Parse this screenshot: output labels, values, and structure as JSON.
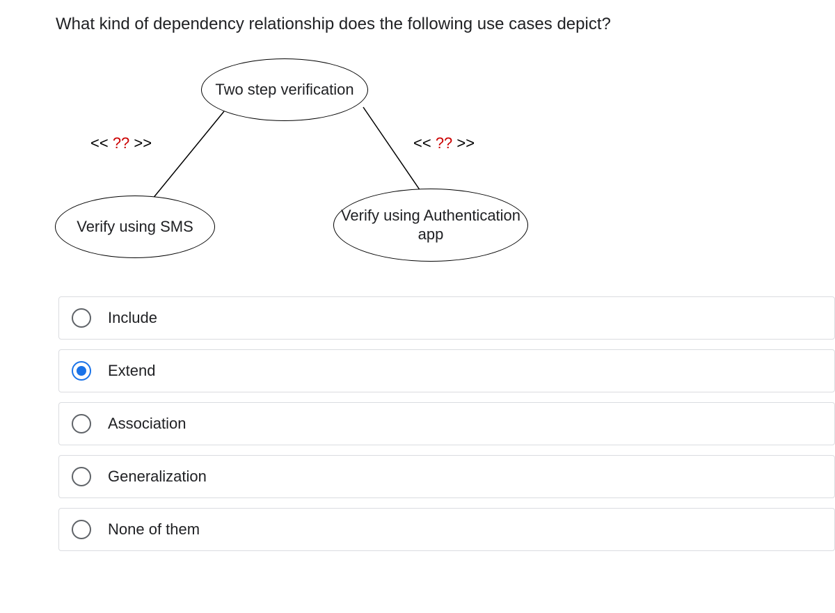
{
  "question": "What kind of dependency relationship does the following use cases depict?",
  "diagram": {
    "top_label": "Two step verification",
    "left_label": "Verify using SMS",
    "right_label": "Verify using Authentication app",
    "stereo_open": "<<",
    "stereo_q": " ?? ",
    "stereo_close": ">>"
  },
  "options": [
    {
      "label": "Include",
      "selected": false
    },
    {
      "label": "Extend",
      "selected": true
    },
    {
      "label": "Association",
      "selected": false
    },
    {
      "label": "Generalization",
      "selected": false
    },
    {
      "label": "None of them",
      "selected": false
    }
  ]
}
